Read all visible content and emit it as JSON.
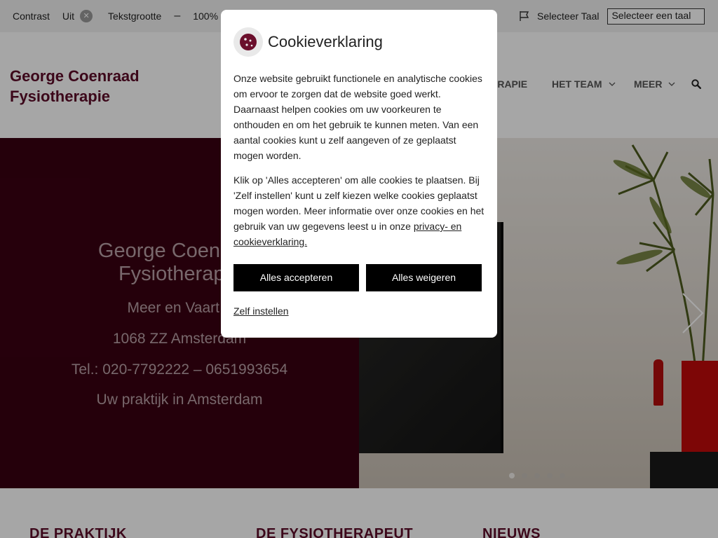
{
  "topbar": {
    "contrast_label": "Contrast",
    "contrast_value": "Uit",
    "contrast_toggle_icon": "x-icon",
    "textsize_label": "Tekstgrootte",
    "decrease": "–",
    "textsize_value": "100%",
    "increase": "+",
    "language_label": "Selecteer Taal",
    "language_select_value": "Selecteer een taal"
  },
  "header": {
    "logo_line1": "George Coenraad",
    "logo_line2": "Fysiotherapie",
    "nav": [
      {
        "label": "ERAPIE"
      },
      {
        "label": "HET TEAM"
      },
      {
        "label": "MEER"
      }
    ]
  },
  "hero": {
    "title_line1": "George Coenraad",
    "title_line2": "Fysiotherapie",
    "line1": "Meer en Vaart 1",
    "line2": "1068 ZZ Amsterdam",
    "line3": "Tel.: 020-7792222 – 0651993654",
    "line4": "Uw praktijk in Amsterdam",
    "slides_total": 5,
    "active_slide": 1
  },
  "sections": {
    "col1": "DE PRAKTIJK",
    "col2": "DE FYSIOTHERAPEUT",
    "col3": "NIEUWS"
  },
  "cookie_modal": {
    "title": "Cookieverklaring",
    "paragraph1": "Onze website gebruikt functionele en analytische cookies om ervoor te zorgen dat de website goed werkt. Daarnaast helpen cookies om uw voorkeuren te onthouden en om het gebruik te kunnen meten. Van een aantal cookies kunt u zelf aangeven of ze geplaatst mogen worden.",
    "paragraph2_text": "Klik op 'Alles accepteren' om alle cookies te plaatsen. Bij 'Zelf instellen' kunt u zelf kiezen welke cookies geplaatst mogen worden. Meer informatie over onze cookies en het gebruik van uw gegevens leest u in onze ",
    "paragraph2_link": "privacy- en cookieverklaring.",
    "accept_label": "Alles accepteren",
    "reject_label": "Alles weigeren",
    "custom_label": "Zelf instellen"
  },
  "colors": {
    "brand": "#5c0b28",
    "hero_bg": "#3a0012",
    "button_bg": "#000000"
  }
}
